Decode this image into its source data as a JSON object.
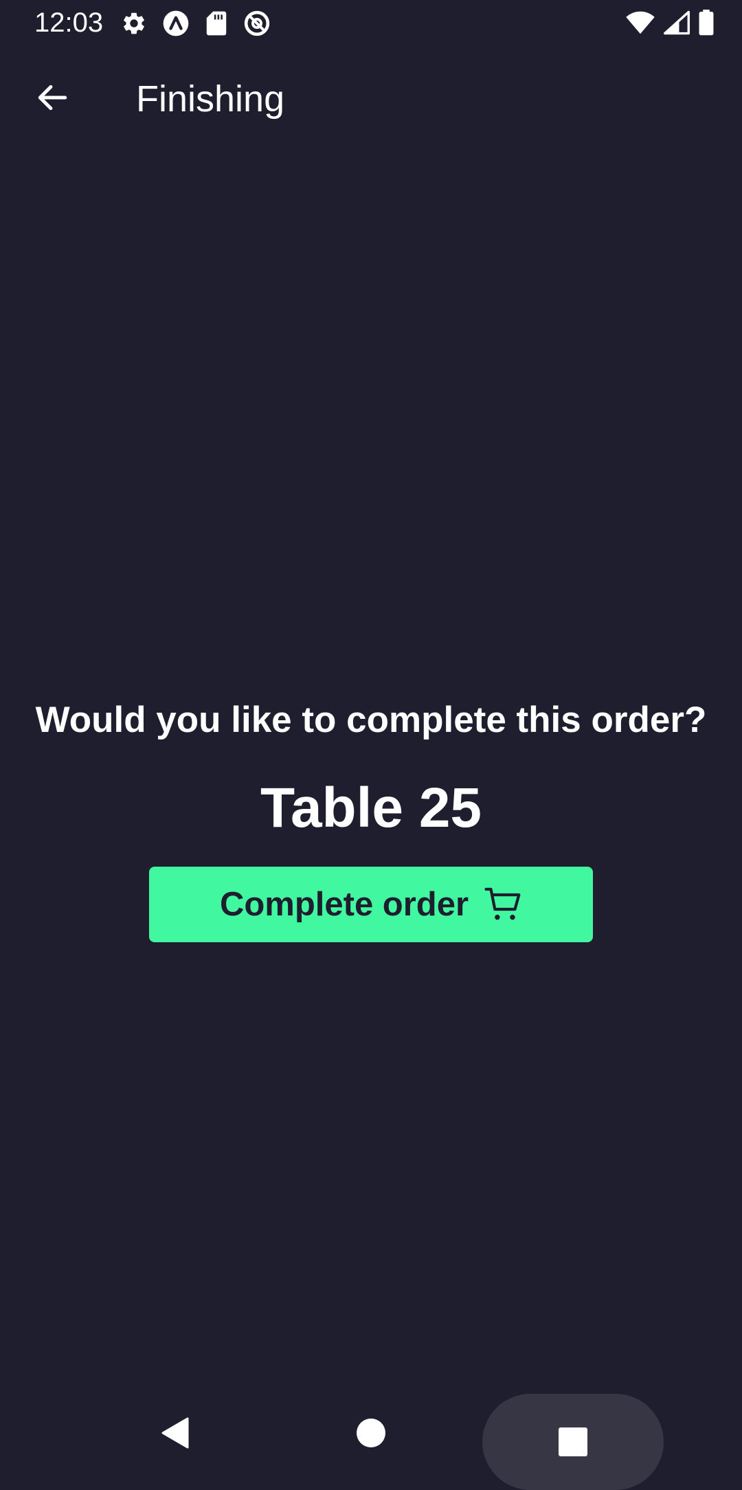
{
  "status_bar": {
    "time": "12:03",
    "left_icons": [
      "gear-icon",
      "app-badge-icon",
      "sd-card-icon",
      "at-sign-icon"
    ],
    "right_icons": [
      "wifi-icon",
      "cellular-signal-icon",
      "battery-icon"
    ]
  },
  "app_bar": {
    "title": "Finishing",
    "back_icon": "arrow-left-icon"
  },
  "main": {
    "prompt": "Would you like to complete this order?",
    "table_label": "Table 25",
    "complete_button": {
      "label": "Complete order",
      "icon": "cart-icon"
    }
  },
  "nav_bar": {
    "icons": [
      "nav-back-icon",
      "nav-home-icon",
      "nav-recents-icon"
    ]
  },
  "colors": {
    "background": "#1f1e2e",
    "accent": "#41f8a1",
    "text": "#ffffff",
    "button_text": "#1f1e2e",
    "nav_pill": "#373645"
  }
}
